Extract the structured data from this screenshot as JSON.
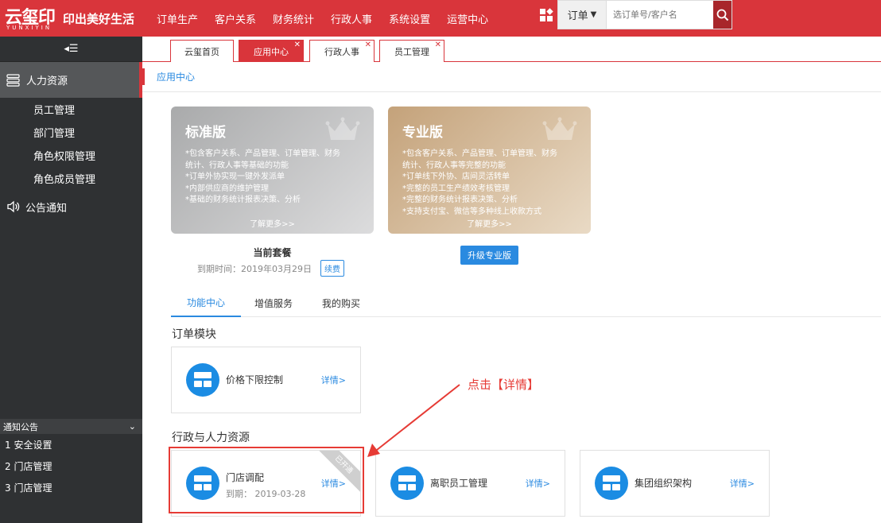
{
  "header": {
    "logo_main": "云玺印",
    "logo_sub": "YUNXIYIN",
    "slogan": "印出美好生活",
    "nav": [
      "订单生产",
      "客户关系",
      "财务统计",
      "行政人事",
      "系统设置",
      "运营中心"
    ],
    "search": {
      "type": "订单",
      "placeholder": "选订单号/客户名"
    }
  },
  "sidebar": {
    "group_label": "人力资源",
    "items": [
      "员工管理",
      "部门管理",
      "角色权限管理",
      "角色成员管理"
    ],
    "notice_label": "公告通知"
  },
  "notice_panel": {
    "title": "通知公告",
    "items": [
      "1 安全设置",
      "2 门店管理",
      "3 门店管理"
    ]
  },
  "tabs": [
    {
      "label": "云玺首页",
      "closable": false
    },
    {
      "label": "应用中心",
      "closable": true,
      "active": true
    },
    {
      "label": "行政人事",
      "closable": true
    },
    {
      "label": "员工管理",
      "closable": true
    }
  ],
  "breadcrumb": "应用中心",
  "plans": {
    "standard": {
      "title": "标准版",
      "features": [
        "*包含客户关系、产品管理、订单管理、财务",
        "统计、行政人事等基础的功能",
        "*订单外协实现一键外发派单",
        "*内部供应商的维护管理",
        "*基础的财务统计报表决策、分析"
      ],
      "more": "了解更多>>",
      "current_label": "当前套餐",
      "expiry": "到期时间：2019年03月29日",
      "renew": "续费"
    },
    "pro": {
      "title": "专业版",
      "features": [
        "*包含客户关系、产品管理、订单管理、财务",
        "统计、行政人事等完整的功能",
        "*订单线下外协、店间灵活转单",
        "*完整的员工生产绩效考核管理",
        "*完整的财务统计报表决策、分析",
        "*支持支付宝、微信等多种线上收款方式"
      ],
      "more": "了解更多>>",
      "upgrade": "升级专业版"
    }
  },
  "func_tabs": [
    "功能中心",
    "增值服务",
    "我的购买"
  ],
  "sections": {
    "order": {
      "title": "订单模块",
      "cards": [
        {
          "title": "价格下限控制",
          "detail": "详情>"
        }
      ]
    },
    "hr": {
      "title": "行政与人力资源",
      "cards": [
        {
          "title": "门店调配",
          "sub": "到期： 2019-03-28",
          "detail": "详情>",
          "ribbon": "已开通"
        },
        {
          "title": "离职员工管理",
          "detail": "详情>"
        },
        {
          "title": "集团组织架构",
          "detail": "详情>"
        }
      ]
    }
  },
  "annotation": "点击【详情】",
  "colors": {
    "brand": "#d9353b",
    "accent": "#2a8ae0",
    "annotation": "#e63b35",
    "sidebar": "#2f3133"
  }
}
